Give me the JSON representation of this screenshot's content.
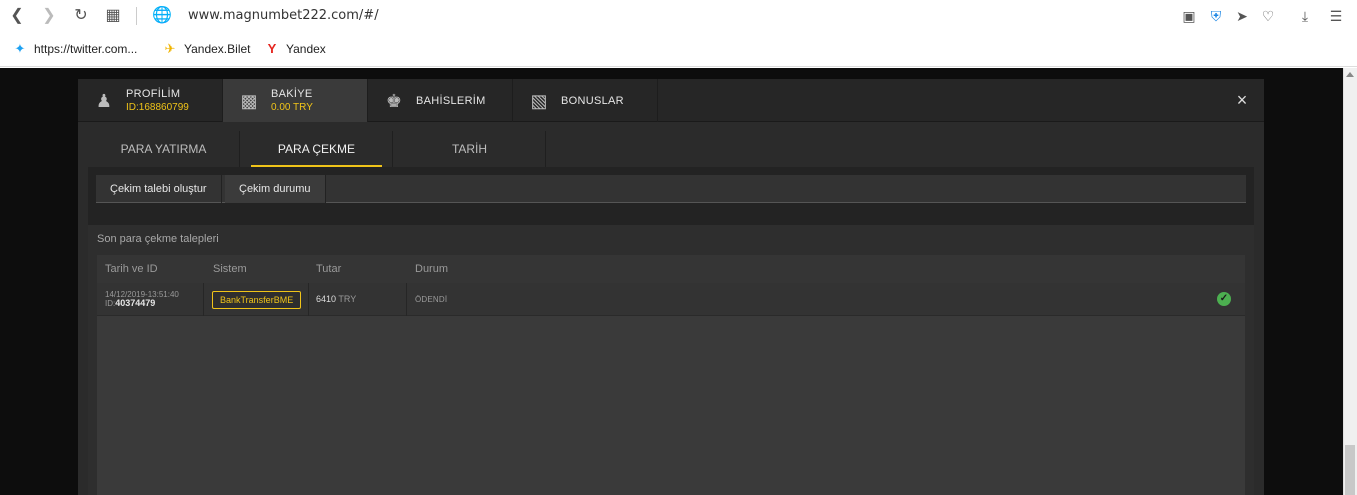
{
  "browser": {
    "url": "www.magnumbet222.com/#/",
    "bookmarks": [
      {
        "label": "https://twitter.com..."
      },
      {
        "label": "Yandex.Bilet"
      },
      {
        "label": "Yandex"
      }
    ]
  },
  "modal": {
    "tabs": [
      {
        "label": "PROFİLİM",
        "sub": "ID:168860799",
        "icon": "user-icon"
      },
      {
        "label": "BAKİYE",
        "sub": "0.00 TRY",
        "icon": "wallet-icon"
      },
      {
        "label": "BAHİSLERİM",
        "sub": "",
        "icon": "trophy-icon"
      },
      {
        "label": "BONUSLAR",
        "sub": "",
        "icon": "gift-icon"
      }
    ],
    "close_label": "×",
    "subtabs": [
      "PARA YATIRMA",
      "PARA ÇEKME",
      "TARİH"
    ],
    "actions": [
      "Çekim talebi oluştur",
      "Çekim durumu"
    ],
    "panel_title": "Son para çekme talepleri",
    "table": {
      "headers": [
        "Tarih ve ID",
        "Sistem",
        "Tutar",
        "Durum"
      ],
      "rows": [
        {
          "date": "14/12/2019-13:51:40",
          "id_prefix": "ID:",
          "id": "40374479",
          "system": "BankTransferBME",
          "amount": "6410",
          "currency": "TRY",
          "status": "ÖDENDİ"
        }
      ]
    }
  },
  "colors": {
    "accent": "#f0c419",
    "success": "#4caf50"
  }
}
